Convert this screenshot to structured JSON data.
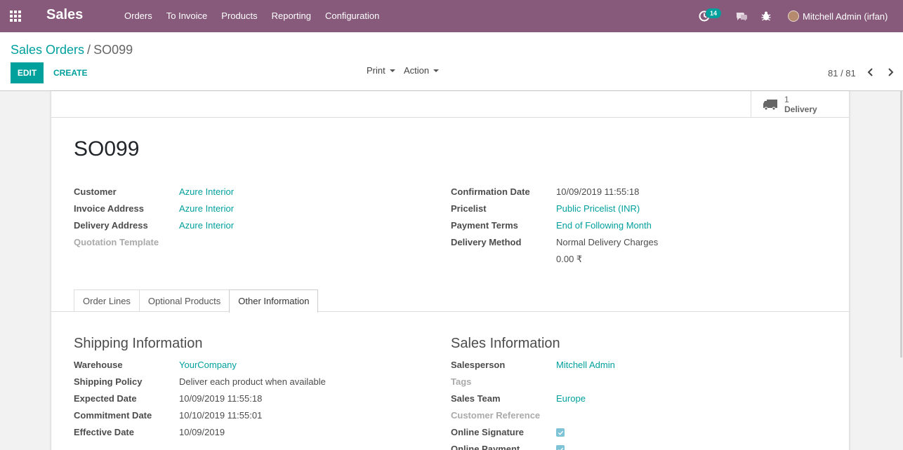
{
  "navbar": {
    "brand": "Sales",
    "menu": [
      "Orders",
      "To Invoice",
      "Products",
      "Reporting",
      "Configuration"
    ],
    "activity_count": "14",
    "user_name": "Mitchell Admin (irfan)",
    "color": "#875a7b"
  },
  "control_panel": {
    "breadcrumb_parent": "Sales Orders",
    "breadcrumb_separator": "/",
    "breadcrumb_current": "SO099",
    "edit_label": "EDIT",
    "create_label": "CREATE",
    "print_label": "Print",
    "action_label": "Action",
    "pager": "81 / 81"
  },
  "smart_button": {
    "count": "1",
    "label": "Delivery"
  },
  "form": {
    "title": "SO099",
    "left_fields": [
      {
        "label": "Customer",
        "value": "Azure Interior"
      },
      {
        "label": "Invoice Address",
        "value": "Azure Interior"
      },
      {
        "label": "Delivery Address",
        "value": "Azure Interior"
      },
      {
        "label": "Quotation Template",
        "value": ""
      }
    ],
    "right_fields": [
      {
        "label": "Confirmation Date",
        "value": "10/09/2019 11:55:18"
      },
      {
        "label": "Pricelist",
        "value": "Public Pricelist (INR)"
      },
      {
        "label": "Payment Terms",
        "value": "End of Following Month"
      },
      {
        "label": "Delivery Method",
        "value": "Normal Delivery Charges"
      }
    ],
    "delivery_price": "0.00 ₹"
  },
  "tabs": [
    "Order Lines",
    "Optional Products",
    "Other Information"
  ],
  "shipping": {
    "title": "Shipping Information",
    "fields": [
      {
        "label": "Warehouse",
        "value": "YourCompany"
      },
      {
        "label": "Shipping Policy",
        "value": "Deliver each product when available"
      },
      {
        "label": "Expected Date",
        "value": "10/09/2019 11:55:18"
      },
      {
        "label": "Commitment Date",
        "value": "10/10/2019 11:55:01"
      },
      {
        "label": "Effective Date",
        "value": "10/09/2019"
      }
    ]
  },
  "sales_info": {
    "title": "Sales Information",
    "fields": [
      {
        "label": "Salesperson",
        "value": "Mitchell Admin"
      },
      {
        "label": "Tags",
        "value": ""
      },
      {
        "label": "Sales Team",
        "value": "Europe"
      },
      {
        "label": "Customer Reference",
        "value": ""
      },
      {
        "label": "Online Signature",
        "value": ""
      },
      {
        "label": "Online Payment",
        "value": ""
      }
    ]
  }
}
